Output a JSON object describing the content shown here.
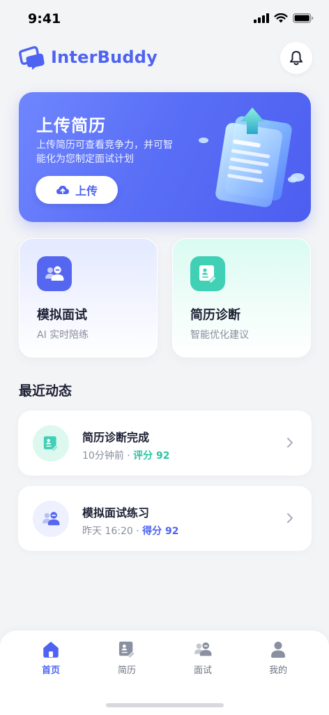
{
  "status_bar": {
    "time": "9:41"
  },
  "header": {
    "app_title": "InterBuddy"
  },
  "upload": {
    "title": "上传简历",
    "description": "上传简历可查看竞争力，并可智能化为您制定面试计划",
    "button_label": "上传"
  },
  "features": [
    {
      "title": "模拟面试",
      "subtitle": "AI 实时陪练"
    },
    {
      "title": "简历诊断",
      "subtitle": "智能优化建议"
    }
  ],
  "recent": {
    "section_title": "最近动态",
    "items": [
      {
        "title": "简历诊断完成",
        "time": "10分钟前 · ",
        "score": "评分 92"
      },
      {
        "title": "模拟面试练习",
        "time": "昨天 16:20 · ",
        "score": "得分 92"
      }
    ]
  },
  "tabs": [
    {
      "label": "首页"
    },
    {
      "label": "简历"
    },
    {
      "label": "面试"
    },
    {
      "label": "我的"
    }
  ],
  "colors": {
    "primary": "#4e63f2",
    "teal": "#3fd0b5",
    "background": "#f3f4f6"
  },
  "active_tab": "首页"
}
